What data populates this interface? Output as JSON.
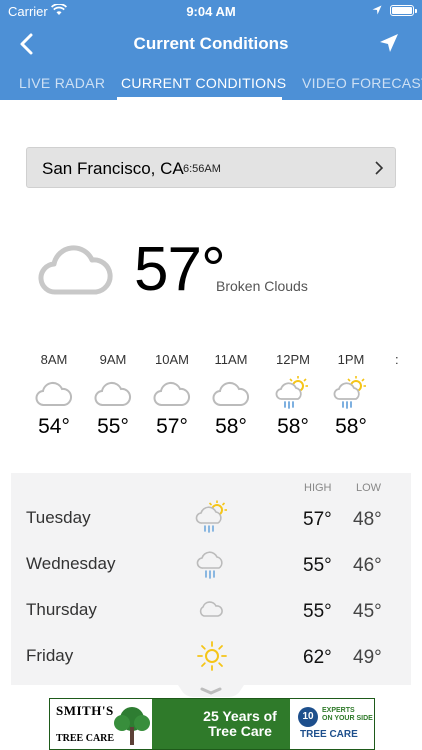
{
  "status_bar": {
    "carrier": "Carrier",
    "time": "9:04 AM"
  },
  "navbar": {
    "title": "Current Conditions"
  },
  "tabs": [
    {
      "label": "LIVE RADAR",
      "active": false
    },
    {
      "label": "CURRENT CONDITIONS",
      "active": true
    },
    {
      "label": "VIDEO FORECAST",
      "active": false
    }
  ],
  "location": {
    "city": "San Francisco, CA",
    "time": "6:56AM"
  },
  "current": {
    "temp": "57°",
    "description": "Broken Clouds",
    "icon": "cloud-icon"
  },
  "hourly": [
    {
      "hour": "8AM",
      "temp": "54°",
      "icon": "cloud-icon"
    },
    {
      "hour": "9AM",
      "temp": "55°",
      "icon": "cloud-icon"
    },
    {
      "hour": "10AM",
      "temp": "57°",
      "icon": "cloud-icon"
    },
    {
      "hour": "11AM",
      "temp": "58°",
      "icon": "cloud-icon"
    },
    {
      "hour": "12PM",
      "temp": "58°",
      "icon": "sun-rain-icon"
    },
    {
      "hour": "1PM",
      "temp": "58°",
      "icon": "sun-rain-icon"
    }
  ],
  "hourly_more": ":",
  "daily": {
    "high_label": "HIGH",
    "low_label": "LOW",
    "days": [
      {
        "day": "Tuesday",
        "high": "57°",
        "low": "48°",
        "icon": "sun-rain-icon"
      },
      {
        "day": "Wednesday",
        "high": "55°",
        "low": "46°",
        "icon": "rain-icon"
      },
      {
        "day": "Thursday",
        "high": "55°",
        "low": "45°",
        "icon": "cloud-icon"
      },
      {
        "day": "Friday",
        "high": "62°",
        "low": "49°",
        "icon": "sun-icon"
      }
    ]
  },
  "ad": {
    "brand": "SMITH'S",
    "brand_sub": "TREE CARE",
    "headline_1": "25 Years of",
    "headline_2": "Tree Care",
    "badge": "10",
    "experts_1": "EXPERTS",
    "experts_2": "ON YOUR SIDE",
    "right_title": "TREE CARE"
  },
  "colors": {
    "header": "#4d90d6",
    "daily_bg": "#f3f3f4",
    "location_bg": "#e3e3e3",
    "sun": "#f5c518",
    "rain": "#6fa8dc"
  }
}
